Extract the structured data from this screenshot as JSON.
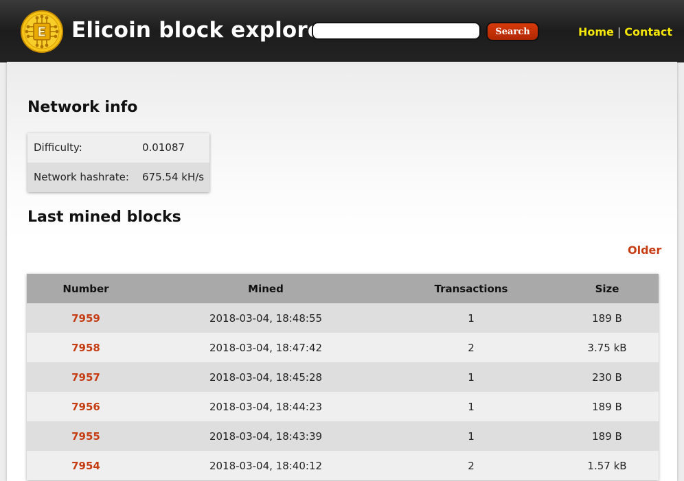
{
  "header": {
    "title": "Elicoin block explorer",
    "logo_icon": "elicoin-logo-icon",
    "search": {
      "placeholder": "",
      "value": "",
      "button_label": "Search"
    },
    "nav": [
      {
        "label": "Home"
      },
      {
        "label": "Contact"
      }
    ],
    "nav_separator": "|",
    "colors": {
      "nav_link": "#f5e60a",
      "accent": "#c63c13",
      "search_button": "#c9330a"
    }
  },
  "network_info": {
    "heading": "Network info",
    "rows": [
      {
        "label": "Difficulty:",
        "value": "0.01087"
      },
      {
        "label": "Network hashrate:",
        "value": "675.54 kH/s"
      }
    ]
  },
  "last_blocks": {
    "heading": "Last mined blocks",
    "older_label": "Older",
    "columns": [
      "Number",
      "Mined",
      "Transactions",
      "Size"
    ],
    "rows": [
      {
        "number": "7959",
        "mined": "2018-03-04, 18:48:55",
        "transactions": "1",
        "size": "189 B"
      },
      {
        "number": "7958",
        "mined": "2018-03-04, 18:47:42",
        "transactions": "2",
        "size": "3.75 kB"
      },
      {
        "number": "7957",
        "mined": "2018-03-04, 18:45:28",
        "transactions": "1",
        "size": "230 B"
      },
      {
        "number": "7956",
        "mined": "2018-03-04, 18:44:23",
        "transactions": "1",
        "size": "189 B"
      },
      {
        "number": "7955",
        "mined": "2018-03-04, 18:43:39",
        "transactions": "1",
        "size": "189 B"
      },
      {
        "number": "7954",
        "mined": "2018-03-04, 18:40:12",
        "transactions": "2",
        "size": "1.57 kB"
      }
    ]
  }
}
